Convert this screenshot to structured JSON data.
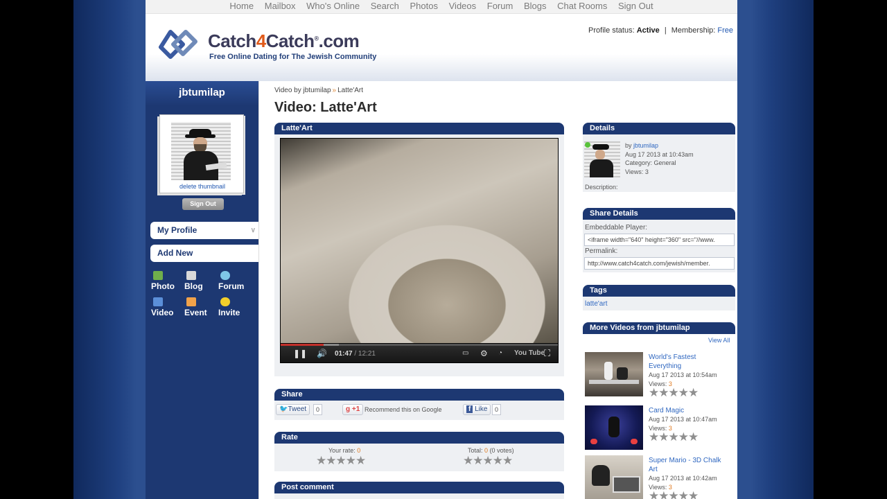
{
  "nav": [
    "Home",
    "Mailbox",
    "Who's Online",
    "Search",
    "Photos",
    "Videos",
    "Forum",
    "Blogs",
    "Chat Rooms",
    "Sign Out"
  ],
  "header": {
    "logo_a": "Catch",
    "logo_b": "4",
    "logo_c": "Catch",
    "logo_reg": "®",
    "logo_d": ".com",
    "tagline": "Free Online Dating for The Jewish Community",
    "status_label": "Profile status:",
    "status_value": "Active",
    "membership_label": "Membership:",
    "membership_value": "Free"
  },
  "sidebar": {
    "username": "jbtumilap",
    "delete_thumb": "delete thumbnail",
    "signout": "Sign Out",
    "my_profile": "My Profile",
    "add_new": "Add New",
    "quick": [
      "Photo",
      "Blog",
      "Forum",
      "Video",
      "Event",
      "Invite"
    ]
  },
  "main": {
    "crumb_a": "Video by jbtumilap",
    "crumb_sep": "»",
    "crumb_b": "Latte'Art",
    "title": "Video: Latte'Art",
    "video_panel": "Latte'Art",
    "player": {
      "time": "01:47",
      "duration": "/ 12:21",
      "progress": 0.155,
      "buffered": 0.21,
      "brand": "You Tube"
    },
    "share_panel": "Share",
    "tweet": "Tweet",
    "tweet_count": "0",
    "gplus": "+1",
    "recommend": "Recommend this on Google",
    "like": "Like",
    "like_count": "0",
    "rate_panel": "Rate",
    "your_rate_label": "Your rate:",
    "your_rate_value": "0",
    "total_label": "Total:",
    "total_value": "0",
    "total_votes": "(0 votes)",
    "post_panel": "Post comment"
  },
  "details": {
    "title": "Details",
    "by_label": "by",
    "by_user": "jbtumilap",
    "date": "Aug 17 2013 at 10:43am",
    "category": "Category: General",
    "views": "Views: 3",
    "description": "Description:"
  },
  "share_details": {
    "title": "Share Details",
    "embed_label": "Embeddable Player:",
    "embed_value": "<iframe width=\"640\" height=\"360\" src=\"//www.",
    "permalink_label": "Permalink:",
    "permalink_value": "http://www.catch4catch.com/jewish/member."
  },
  "tags": {
    "title": "Tags",
    "items": [
      "latte'art"
    ]
  },
  "more_videos": {
    "title": "More Videos from jbtumilap",
    "view_all": "View All",
    "items": [
      {
        "title": "World's Fastest Everything",
        "date": "Aug 17 2013 at 10:54am",
        "views_label": "Views:",
        "views": "3"
      },
      {
        "title": "Card Magic",
        "date": "Aug 17 2013 at 10:47am",
        "views_label": "Views:",
        "views": "3"
      },
      {
        "title": "Super Mario - 3D Chalk Art",
        "date": "Aug 17 2013 at 10:42am",
        "views_label": "Views:",
        "views": "3"
      }
    ]
  },
  "stars": "★★★★★",
  "colors": {
    "navy": "#1d3872",
    "link": "#2f67c0",
    "accent": "#e07a20"
  }
}
